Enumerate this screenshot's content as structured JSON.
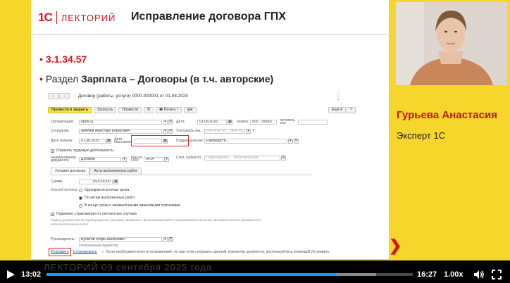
{
  "slide": {
    "logo_mark": "1С",
    "logo_name": "ЛЕКТОРИЙ",
    "title": "Исправление договора ГПХ",
    "bullet_1": "3.1.34.57",
    "bullet_2_prefix": "Раздел ",
    "bullet_2_bold": "Зарплата – Договоры (в т.ч. авторские)"
  },
  "form": {
    "window_title": "Договор (работы, услуги) 0000-000001 от 01.08.2025",
    "toolbar": {
      "post_close": "Провести и закрыть",
      "save": "Записать",
      "post": "Провести",
      "print": "Печать",
      "more": "Ещё",
      "help": "?"
    },
    "fields": {
      "org_label": "Организация:",
      "org_value": "Крон-Ц",
      "date_label": "Дата:",
      "date_value": "01.08.2025",
      "number_label": "Номер:",
      "number_value": "00с…00001",
      "print_as_label": "печатать как:",
      "employee_label": "Сотрудник:",
      "employee_value": "Минчев Аристарх Борисович",
      "account_label": "Учитывать как:",
      "account_value": "Расчеты по… (вне пр…)",
      "start_label": "Дата начала:",
      "start_value": "01.08.2025",
      "end_label": "Дата окончания:",
      "end_value": "",
      "dept_label": "Подразделение:",
      "dept_value": "Руководств…",
      "labor_check": "Отразить трудовую деятельность",
      "doc_name_label": "Наименование документа:",
      "doc_name_value": "Договор",
      "okz_label": "Код по ОКЗ:",
      "okz_value": "5414",
      "invoice_label": "Счет, субконто:",
      "invoice_value": "Подразделен… Номенклатура"
    },
    "tabs": [
      "Условия договора",
      "Акты выполненных работ"
    ],
    "terms": {
      "sum_label": "Сумма:",
      "sum_value": "150 000,00",
      "payment_label": "Способ оплаты:",
      "option_1": "Однократно в конце срока",
      "option_2": "По актам выполненных работ",
      "option_3": "В конце срока с ежемесячными авансовыми платежами",
      "insurance_check": "Подлежит страхованию от несчастных случаев",
      "note": "Размер документально подтвержденных расходов, связанных с выполнением работ и принимаемых в качестве налогового вычета указывается в актах выполненных работ."
    },
    "manager_label": "Руководитель:",
    "manager_value": "Булатов Игорь Валенович",
    "manager_role": "Генеральный директор",
    "fix_link": "Исправить",
    "reverse_link": "Сторнировать",
    "footer_note": "Если необходимо внести исправление, но при этом сохранить данный экземпляр документа, воспользуйтесь командой Исправить"
  },
  "presenter": {
    "name": "Гурьева Анастасия",
    "role": "Эксперт 1С"
  },
  "player": {
    "overlay_text": "ЛЕКТОРИЙ    09 сентября 2025 года",
    "current_time": "13:02",
    "duration": "16:27",
    "speed": "1.00x",
    "progress": 0.792,
    "buffered": 0.9
  },
  "colors": {
    "background": "#f6d62a",
    "brand_red": "#d7141a",
    "progress": "#00a2ff"
  }
}
